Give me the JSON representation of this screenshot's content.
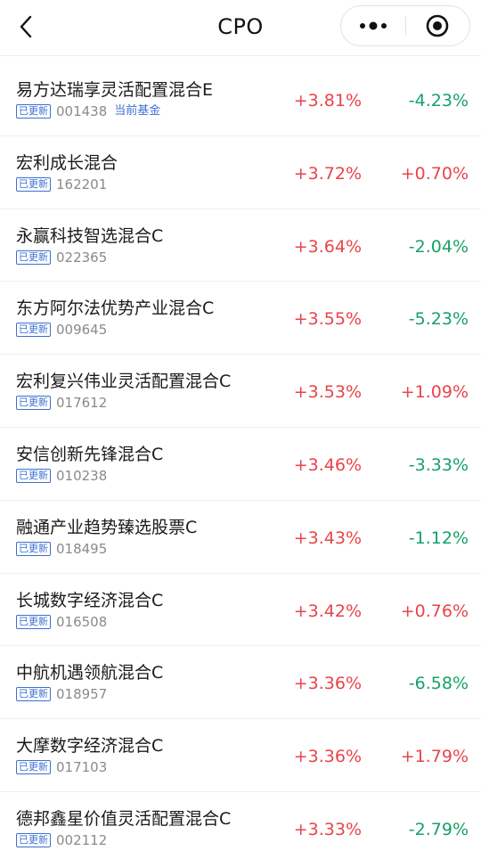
{
  "header": {
    "title": "CPO",
    "back_icon": "chevron-left-icon",
    "more_icon": "more-dots-icon",
    "close_icon": "target-circle-icon"
  },
  "colors": {
    "up": "#e8444a",
    "down": "#17a06a",
    "badge": "#3d6fd1"
  },
  "funds": [
    {
      "name": "易方达瑞享灵活配置混合E",
      "badge": "已更新",
      "code": "001438",
      "tag": "当前基金",
      "change1": "+3.81%",
      "change1_dir": "up",
      "change2": "-4.23%",
      "change2_dir": "down"
    },
    {
      "name": "宏利成长混合",
      "badge": "已更新",
      "code": "162201",
      "tag": "",
      "change1": "+3.72%",
      "change1_dir": "up",
      "change2": "+0.70%",
      "change2_dir": "up"
    },
    {
      "name": "永赢科技智选混合C",
      "badge": "已更新",
      "code": "022365",
      "tag": "",
      "change1": "+3.64%",
      "change1_dir": "up",
      "change2": "-2.04%",
      "change2_dir": "down"
    },
    {
      "name": "东方阿尔法优势产业混合C",
      "badge": "已更新",
      "code": "009645",
      "tag": "",
      "change1": "+3.55%",
      "change1_dir": "up",
      "change2": "-5.23%",
      "change2_dir": "down"
    },
    {
      "name": "宏利复兴伟业灵活配置混合C",
      "badge": "已更新",
      "code": "017612",
      "tag": "",
      "change1": "+3.53%",
      "change1_dir": "up",
      "change2": "+1.09%",
      "change2_dir": "up"
    },
    {
      "name": "安信创新先锋混合C",
      "badge": "已更新",
      "code": "010238",
      "tag": "",
      "change1": "+3.46%",
      "change1_dir": "up",
      "change2": "-3.33%",
      "change2_dir": "down"
    },
    {
      "name": "融通产业趋势臻选股票C",
      "badge": "已更新",
      "code": "018495",
      "tag": "",
      "change1": "+3.43%",
      "change1_dir": "up",
      "change2": "-1.12%",
      "change2_dir": "down"
    },
    {
      "name": "长城数字经济混合C",
      "badge": "已更新",
      "code": "016508",
      "tag": "",
      "change1": "+3.42%",
      "change1_dir": "up",
      "change2": "+0.76%",
      "change2_dir": "up"
    },
    {
      "name": "中航机遇领航混合C",
      "badge": "已更新",
      "code": "018957",
      "tag": "",
      "change1": "+3.36%",
      "change1_dir": "up",
      "change2": "-6.58%",
      "change2_dir": "down"
    },
    {
      "name": "大摩数字经济混合C",
      "badge": "已更新",
      "code": "017103",
      "tag": "",
      "change1": "+3.36%",
      "change1_dir": "up",
      "change2": "+1.79%",
      "change2_dir": "up"
    },
    {
      "name": "德邦鑫星价值灵活配置混合C",
      "badge": "已更新",
      "code": "002112",
      "tag": "",
      "change1": "+3.33%",
      "change1_dir": "up",
      "change2": "-2.79%",
      "change2_dir": "down"
    }
  ]
}
